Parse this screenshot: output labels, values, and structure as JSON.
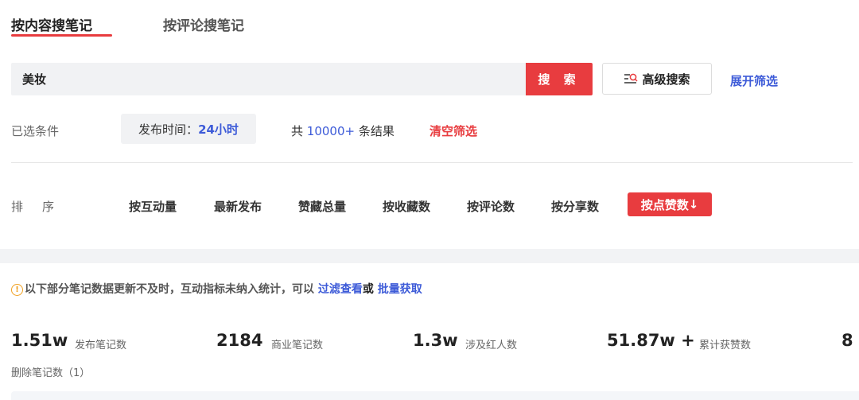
{
  "tabs": [
    {
      "label": "按内容搜笔记",
      "active": true
    },
    {
      "label": "按评论搜笔记",
      "active": false
    }
  ],
  "search": {
    "value": "美妆",
    "button_label": "搜 索",
    "advanced_label": "高级搜索",
    "expand_label": "展开筛选"
  },
  "conditions": {
    "label": "已选条件",
    "chip_key": "发布时间：",
    "chip_value": "24小时",
    "result_prefix": "共",
    "result_count": "10000+",
    "result_suffix": "条结果",
    "clear_label": "清空筛选"
  },
  "sort": {
    "label": "排序",
    "options": [
      "按互动量",
      "最新发布",
      "赞藏总量",
      "按收藏数",
      "按评论数",
      "按分享数"
    ],
    "active": "按点赞数",
    "active_arrow": "↓"
  },
  "notice": {
    "icon": "!",
    "text": "以下部分笔记数据更新不及时，互动指标未纳入统计，可以",
    "link1": "过滤查看",
    "or": "或",
    "link2": "批量获取"
  },
  "stats": [
    {
      "value": "1.51w",
      "label": "发布笔记数"
    },
    {
      "value": "2184",
      "label": "商业笔记数"
    },
    {
      "value": "1.3w",
      "label": "涉及红人数"
    },
    {
      "value": "51.87w +",
      "label": "累计获赞数"
    }
  ],
  "stats_cut_value": "8",
  "deleted_label": "删除笔记数（1）",
  "colors": {
    "accent": "#e83c3f",
    "link": "#3d5bd8",
    "warning": "#f0a020"
  }
}
